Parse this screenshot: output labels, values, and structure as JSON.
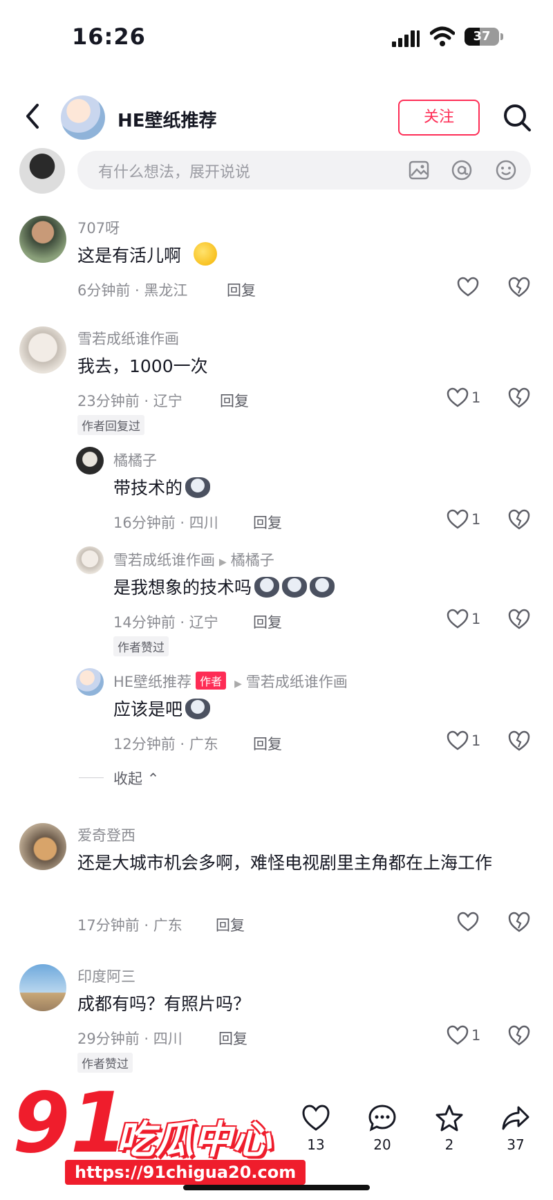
{
  "status_bar": {
    "time": "16:26",
    "battery": "37"
  },
  "header": {
    "title": "HE壁纸推荐",
    "follow_label": "关注"
  },
  "comment_input": {
    "placeholder": "有什么想法，展开说说"
  },
  "comments": [
    {
      "name": "707呀",
      "text": "这是有活儿啊",
      "meta": "6分钟前 · 黑龙江",
      "reply": "回复",
      "likes": ""
    },
    {
      "name": "雪若成纸谁作画",
      "text": "我去，1000一次",
      "meta": "23分钟前 · 辽宁",
      "reply": "回复",
      "likes": "1",
      "badge": "作者回复过"
    },
    {
      "name": "橘橘子",
      "text": "带技术的",
      "meta": "16分钟前 · 四川",
      "reply": "回复",
      "likes": "1"
    },
    {
      "name": "雪若成纸谁作画",
      "reply_to": "橘橘子",
      "text": "是我想象的技术吗",
      "meta": "14分钟前 · 辽宁",
      "reply": "回复",
      "likes": "1",
      "badge": "作者赞过"
    },
    {
      "name": "HE壁纸推荐",
      "author_tag": "作者",
      "reply_to": "雪若成纸谁作画",
      "text": "应该是吧",
      "meta": "12分钟前 · 广东",
      "reply": "回复",
      "likes": "1"
    },
    {
      "name": "爱奇登西",
      "text": "还是大城市机会多啊，难怪电视剧里主角都在上海工作",
      "meta": "17分钟前 · 广东",
      "reply": "回复",
      "likes": ""
    },
    {
      "name": "印度阿三",
      "text": "成都有吗？有照片吗？",
      "meta": "29分钟前 · 四川",
      "reply": "回复",
      "likes": "1",
      "badge": "作者赞过"
    }
  ],
  "collapse_label": "收起",
  "bottom_bar": {
    "likes": "13",
    "comments": "20",
    "favorites": "2",
    "shares": "37"
  },
  "watermark": {
    "number": "91",
    "text": "吃瓜中心",
    "url": "https://91chigua20.com"
  },
  "colors": {
    "accent": "#fe2c55",
    "watermark_red": "#ef1d2c"
  }
}
